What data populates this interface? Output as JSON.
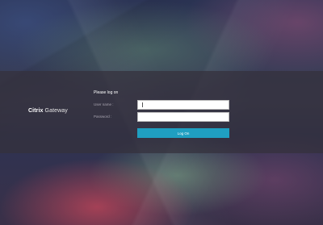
{
  "brand": {
    "name_bold": "Citrix",
    "name_light": "Gateway"
  },
  "login": {
    "title": "Please log on",
    "username_label": "User name :",
    "username_value": "",
    "password_label": "Password :",
    "password_value": "",
    "submit_label": "Log On"
  },
  "colors": {
    "button": "#1f9fc1",
    "band": "#34303c"
  }
}
